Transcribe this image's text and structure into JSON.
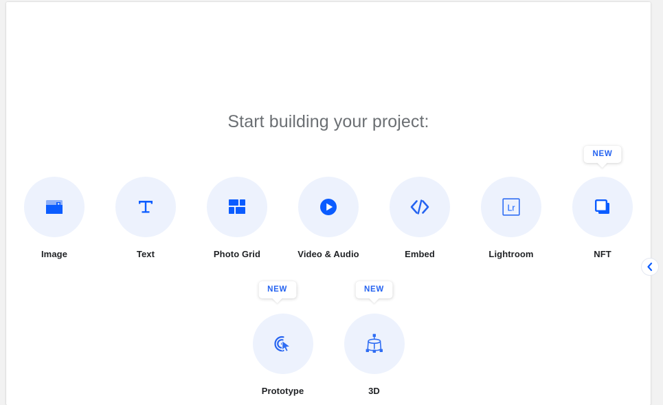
{
  "heading": "Start building your project:",
  "colors": {
    "accent": "#0b5cff",
    "badge_text": "#2563f0",
    "circle_bg": "#edf2fd",
    "label": "#1f2124",
    "heading": "#6b6f73",
    "card_bg": "#ffffff",
    "page_bg": "#f2f2f2"
  },
  "badge_label": "NEW",
  "rows": [
    {
      "name": "primary-block-row",
      "tiles": [
        {
          "label": "Image",
          "icon": "image-icon",
          "badge": null
        },
        {
          "label": "Text",
          "icon": "text-icon",
          "badge": null
        },
        {
          "label": "Photo Grid",
          "icon": "photo-grid-icon",
          "badge": null
        },
        {
          "label": "Video & Audio",
          "icon": "play-icon",
          "badge": null
        },
        {
          "label": "Embed",
          "icon": "code-icon",
          "badge": null
        },
        {
          "label": "Lightroom",
          "icon": "lightroom-icon",
          "badge": null
        },
        {
          "label": "NFT",
          "icon": "nft-icon",
          "badge": "NEW"
        }
      ]
    },
    {
      "name": "secondary-block-row",
      "tiles": [
        {
          "label": "Prototype",
          "icon": "cursor-click-icon",
          "badge": "NEW"
        },
        {
          "label": "3D",
          "icon": "cube-3d-icon",
          "badge": "NEW"
        }
      ]
    }
  ],
  "edge_handle": {
    "icon": "chevron-left-icon"
  }
}
